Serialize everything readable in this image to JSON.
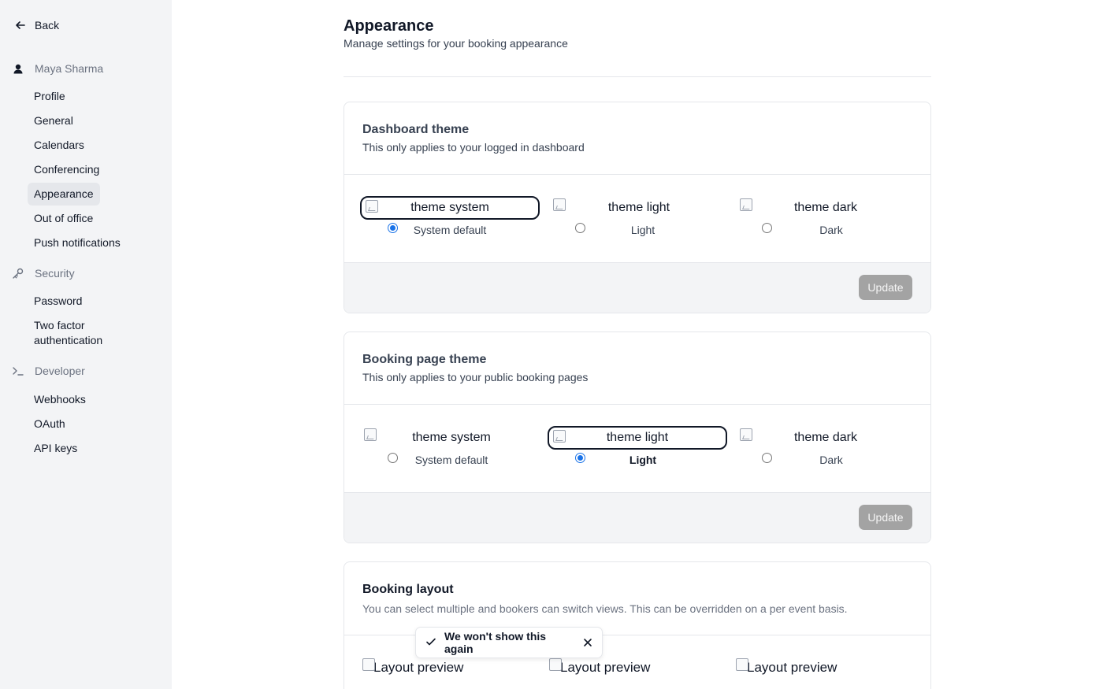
{
  "sidebar": {
    "back_label": "Back",
    "user_group": {
      "title": "Maya Sharma",
      "icon": "user-icon",
      "items": [
        "Profile",
        "General",
        "Calendars",
        "Conferencing",
        "Appearance",
        "Out of office",
        "Push notifications"
      ],
      "active": "Appearance"
    },
    "security_group": {
      "title": "Security",
      "icon": "key-icon",
      "items": [
        "Password",
        "Two factor authentication"
      ]
    },
    "developer_group": {
      "title": "Developer",
      "icon": "terminal-icon",
      "items": [
        "Webhooks",
        "OAuth",
        "API keys"
      ]
    }
  },
  "header": {
    "title": "Appearance",
    "subtitle": "Manage settings for your booking appearance"
  },
  "dashboard_theme": {
    "title": "Dashboard theme",
    "description": "This only applies to your logged in dashboard",
    "options": [
      {
        "image_alt": "theme system",
        "label": "System default",
        "selected": true
      },
      {
        "image_alt": "theme light",
        "label": "Light",
        "selected": false
      },
      {
        "image_alt": "theme dark",
        "label": "Dark",
        "selected": false
      }
    ],
    "update_label": "Update"
  },
  "booking_page_theme": {
    "title": "Booking page theme",
    "description": "This only applies to your public booking pages",
    "options": [
      {
        "image_alt": "theme system",
        "label": "System default",
        "selected": false
      },
      {
        "image_alt": "theme light",
        "label": "Light",
        "selected": true
      },
      {
        "image_alt": "theme dark",
        "label": "Dark",
        "selected": false
      }
    ],
    "update_label": "Update"
  },
  "booking_layout": {
    "title": "Booking layout",
    "description": "You can select multiple and bookers can switch views. This can be overridden on a per event basis.",
    "previews": [
      "Layout preview",
      "Layout preview",
      "Layout preview"
    ]
  },
  "toast": {
    "message": "We won't show this again",
    "icon": "check-icon",
    "close_icon": "close-icon"
  },
  "colors": {
    "sidebar_bg": "#f3f4f6",
    "disabled_button": "#a3a3a3",
    "radio_accent": "#1a73e8"
  }
}
